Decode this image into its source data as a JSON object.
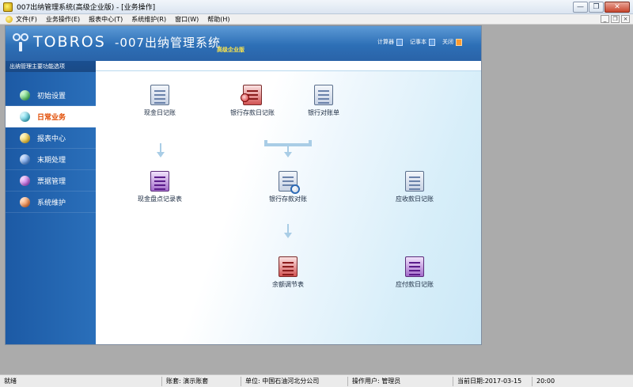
{
  "window": {
    "title": "007出纳管理系统(高级企业版) - [业务操作]",
    "controls": {
      "minimize": "—",
      "restore": "❐",
      "close": "✕"
    }
  },
  "menu": {
    "items": [
      "文件(F)",
      "业务操作(E)",
      "报表中心(T)",
      "系统维护(R)",
      "窗口(W)",
      "帮助(H)"
    ],
    "mdi_controls": {
      "minimize": "_",
      "restore": "❐",
      "close": "×"
    }
  },
  "header": {
    "brand": "TOBROS",
    "product": "-007出纳管理系统",
    "edition": "高级企业版",
    "links": [
      {
        "label": "计算器",
        "icon": "calculator-icon"
      },
      {
        "label": "记事本",
        "icon": "notepad-icon"
      },
      {
        "label": "关闭",
        "icon": "close-icon"
      }
    ]
  },
  "sidebar": {
    "title": "出纳管理主要功能选项",
    "items": [
      {
        "label": "初始设置",
        "color": "green"
      },
      {
        "label": "日常业务",
        "color": "cyan",
        "active": true
      },
      {
        "label": "报表中心",
        "color": "yellow"
      },
      {
        "label": "末期处理",
        "color": "blue"
      },
      {
        "label": "票据管理",
        "color": "purple"
      },
      {
        "label": "系统维护",
        "color": "orange"
      }
    ]
  },
  "flow": {
    "cash_journal": "现金日记账",
    "bank_journal": "银行存款日记账",
    "bank_statement": "银行对账单",
    "cash_count": "现金盘点记录表",
    "bank_reconcile": "银行存款对账",
    "receivable_journal": "应收款日记账",
    "balance_adjust": "余额调节表",
    "payable_journal": "应付款日记账"
  },
  "status": {
    "state": "就绪",
    "account_label": "账套:",
    "account_value": "演示账套",
    "unit_label": "单位:",
    "unit_value": "中国石油河北分公司",
    "user_label": "操作用户:",
    "user_value": "管理员",
    "date_label": "当前日期:",
    "date_value": "2017-03-15",
    "time_value": "20:00"
  }
}
